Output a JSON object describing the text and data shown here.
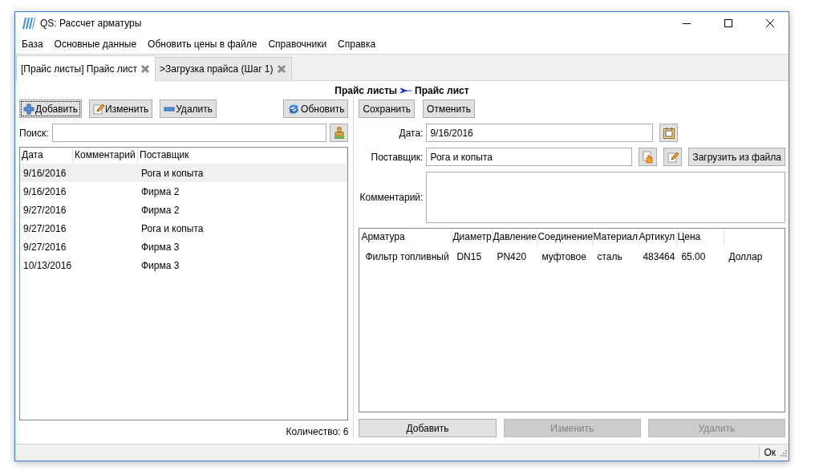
{
  "window": {
    "title": "QS: Рассчет арматуры"
  },
  "menu": [
    "База",
    "Основные данные",
    "Обновить цены в файле",
    "Справочники",
    "Справка"
  ],
  "tabs": [
    {
      "label": "[Прайс листы] Прайс лист",
      "selected": true
    },
    {
      "label": ">Загрузка прайса (Шаг 1)",
      "selected": false
    }
  ],
  "breadcrumb": [
    "Прайс листы",
    "Прайс лист"
  ],
  "list_panel": {
    "toolbar": [
      {
        "kind": "add",
        "label": "Добавить",
        "focused": true
      },
      {
        "kind": "edit",
        "label": "Изменить",
        "focused": false
      },
      {
        "kind": "delete",
        "label": "Удалить",
        "focused": false
      },
      {
        "kind": "refresh",
        "label": "Обновить",
        "focused": false
      }
    ],
    "search": {
      "label": "Поиск:"
    },
    "table": {
      "columns": [
        "Дата",
        "Комментарий",
        "Поставщик"
      ],
      "rows": [
        {
          "date": "9/16/2016",
          "supplier": "Рога и копыта",
          "selected": true
        },
        {
          "date": "9/16/2016",
          "supplier": "Фирма 2",
          "selected": false
        },
        {
          "date": "9/27/2016",
          "supplier": "Фирма 2",
          "selected": false
        },
        {
          "date": "9/27/2016",
          "supplier": "Рога и копыта",
          "selected": false
        },
        {
          "date": "9/27/2016",
          "supplier": "Фирма 3",
          "selected": false
        },
        {
          "date": "10/13/2016",
          "supplier": "Фирма 3",
          "selected": false
        }
      ]
    },
    "count": "Количество: 6"
  },
  "editor": {
    "buttons": [
      "Сохранить",
      "Отменить"
    ],
    "date": {
      "label": "Дата:",
      "value": "9/16/2016"
    },
    "supplier": {
      "label": "Поставщик:",
      "value": "Рога и копыта",
      "load_button": "Загрузить из файла"
    },
    "comment": {
      "label": "Комментарий:"
    },
    "items_table": {
      "columns": [
        "Арматура",
        "Диаметр",
        "Давление",
        "Соединение",
        "Материал",
        "Артикул",
        "Цена"
      ],
      "rows": [
        [
          "Фильтр топливный",
          "DN15",
          "PN420",
          "муфтовое",
          "сталь",
          "483464",
          "65.00",
          "Доллар"
        ]
      ]
    },
    "actions": [
      {
        "label": "Добавить",
        "disabled": false
      },
      {
        "label": "Изменить",
        "disabled": true
      },
      {
        "label": "Удалить",
        "disabled": true
      }
    ]
  },
  "status_bar": {
    "text": "Ок"
  }
}
